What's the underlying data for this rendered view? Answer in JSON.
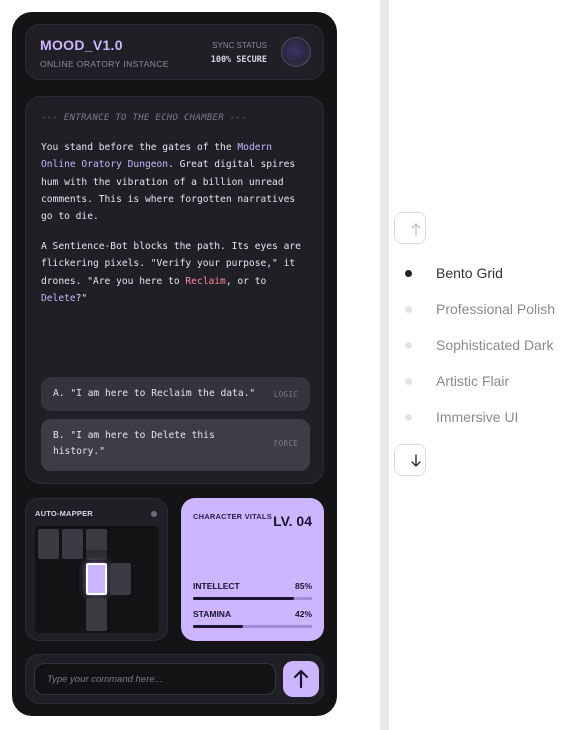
{
  "header": {
    "title": "MOOD_V1.0",
    "subtitle": "ONLINE ORATORY INSTANCE",
    "sync_label": "SYNC STATUS",
    "sync_value": "100% SECURE"
  },
  "story": {
    "heading": "--- ENTRANCE TO THE ECHO CHAMBER ---",
    "p1": {
      "a": "You stand before the gates of the ",
      "hl": "Modern Online Oratory Dungeon",
      "b": ". Great digital spires hum with the vibration of a billion unread comments. This is where forgotten narratives go to die."
    },
    "p2": {
      "a": "A Sentience-Bot blocks the path. Its eyes are flickering pixels. \"Verify your purpose,\" it drones. \"Are you here to ",
      "reclaim": "Reclaim",
      "b": ", or to ",
      "delete": "Delete",
      "c": "?\""
    },
    "choices": [
      {
        "label": "A. \"I am here to Reclaim the data.\"",
        "tag": "LOGIC"
      },
      {
        "label": "B. \"I am here to Delete this history.\"",
        "tag": "FORCE"
      }
    ]
  },
  "mapper": {
    "title": "AUTO-MAPPER"
  },
  "vitals": {
    "title": "CHARACTER VITALS",
    "level": "LV. 04",
    "stats": [
      {
        "name": "INTELLECT",
        "value": "85%",
        "fill": 0.85
      },
      {
        "name": "STAMINA",
        "value": "42%",
        "fill": 0.42
      }
    ]
  },
  "command": {
    "placeholder": "Type your command here..."
  },
  "nav": {
    "items": [
      {
        "label": "Bento Grid",
        "active": true
      },
      {
        "label": "Professional Polish",
        "active": false
      },
      {
        "label": "Sophisticated Dark",
        "active": false
      },
      {
        "label": "Artistic Flair",
        "active": false
      },
      {
        "label": "Immersive UI",
        "active": false
      }
    ]
  },
  "colors": {
    "accent": "#cbb6ff",
    "panel": "#1f1f25",
    "app_bg": "#141417",
    "danger_text": "#ff8aa0"
  },
  "icons": {
    "send": "arrow-up-icon",
    "nav_up": "arrow-up-icon",
    "nav_down": "arrow-down-icon"
  }
}
